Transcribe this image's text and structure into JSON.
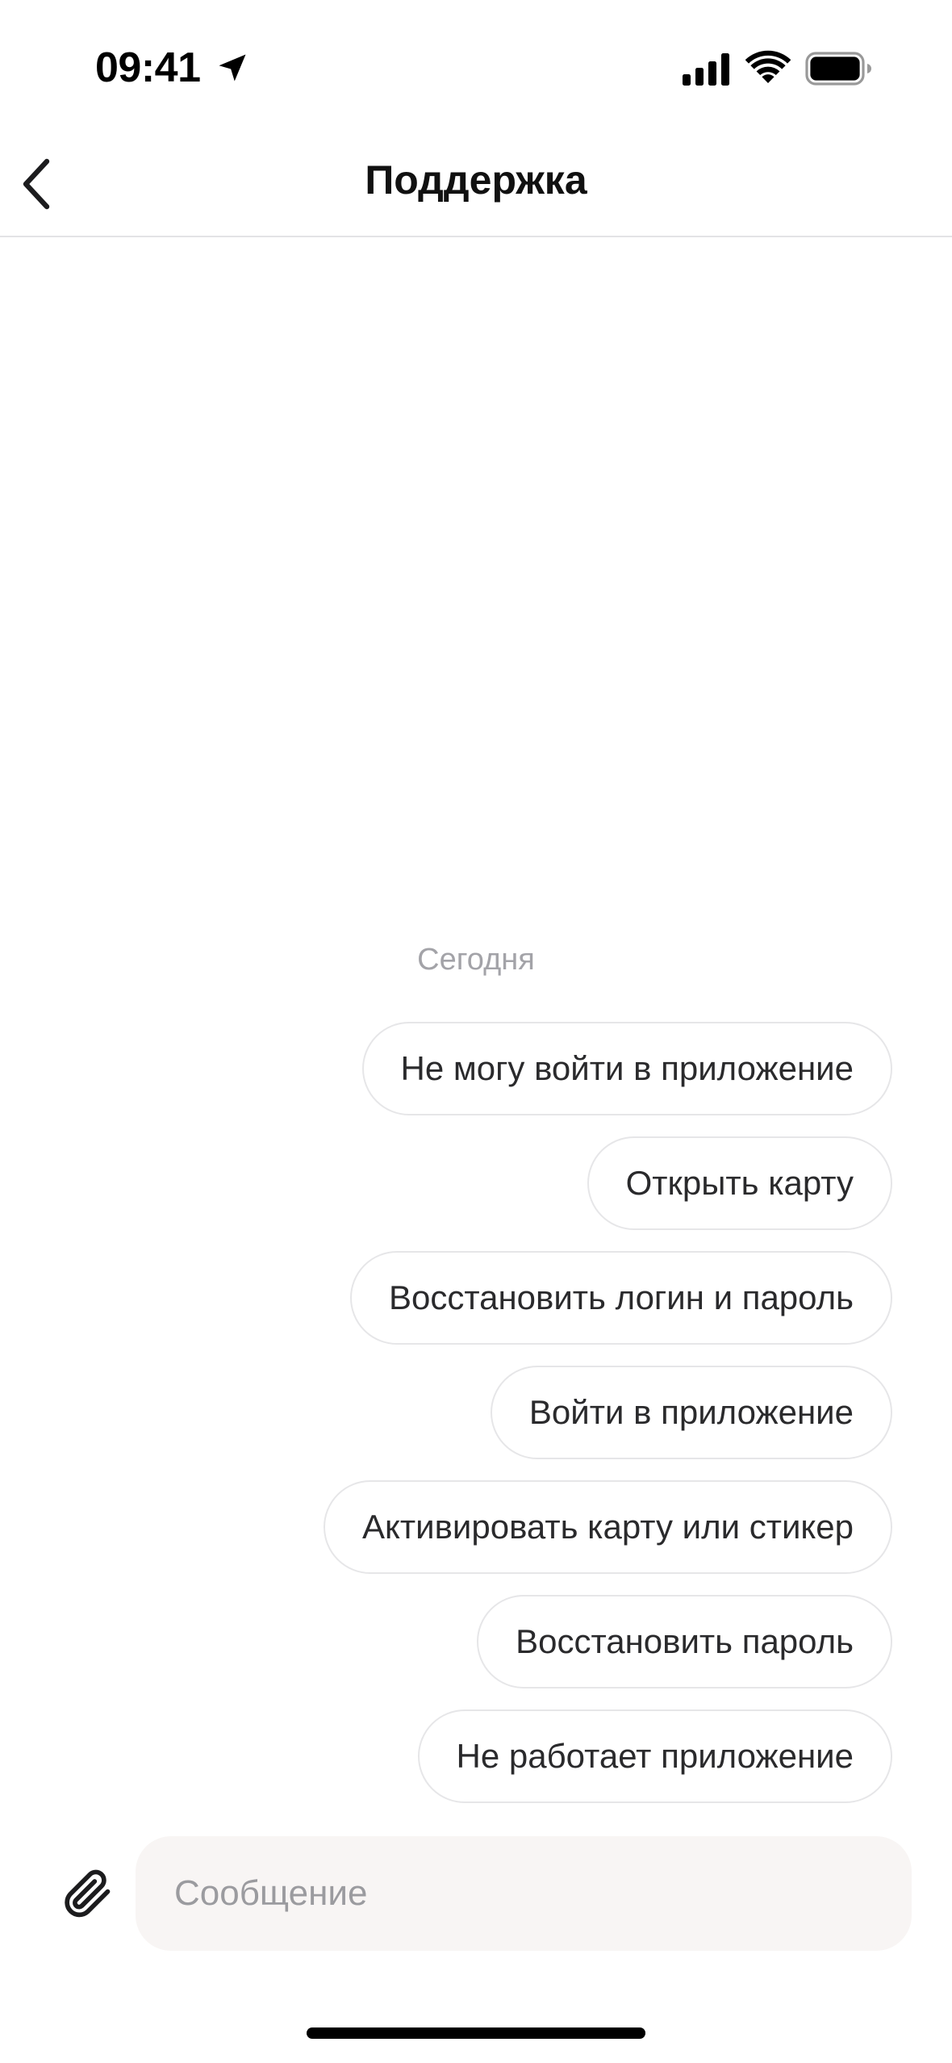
{
  "status_bar": {
    "time": "09:41",
    "icons": [
      "location-arrow-icon",
      "cellular-signal-icon",
      "wifi-icon",
      "battery-icon"
    ]
  },
  "header": {
    "title": "Поддержка",
    "back_icon": "chevron-left-icon"
  },
  "chat": {
    "date_label": "Сегодня",
    "quick_replies": [
      {
        "label": "Не могу войти в приложение"
      },
      {
        "label": "Открыть карту"
      },
      {
        "label": "Восстановить логин и пароль"
      },
      {
        "label": "Войти в приложение"
      },
      {
        "label": "Активировать карту или стикер"
      },
      {
        "label": "Восстановить пароль"
      },
      {
        "label": "Не работает приложение"
      }
    ]
  },
  "composer": {
    "attach_icon": "paperclip-icon",
    "placeholder": "Сообщение",
    "value": ""
  },
  "colors": {
    "chip_border": "#e6e6e8",
    "input_background": "#f8f5f4",
    "muted_text": "#a3a3a8"
  }
}
